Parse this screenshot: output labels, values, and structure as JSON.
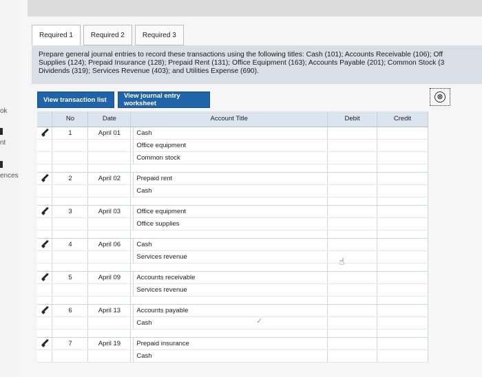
{
  "sidebar_fragments": [
    "ok",
    "nt",
    "ences"
  ],
  "tabs": [
    {
      "label": "Required 1"
    },
    {
      "label": "Required 2"
    },
    {
      "label": "Required 3"
    }
  ],
  "instruction": {
    "line1": "Prepare general journal entries to record these transactions using the following titles: Cash (101); Accounts Receivable (106); Off",
    "line2": "Supplies (124); Prepaid Insurance (128); Prepaid Rent (131); Office Equipment (163); Accounts Payable (201); Common Stock (3",
    "line3": "Dividends (319); Services Revenue (403); and Utilities Expense (690)."
  },
  "buttons": {
    "transaction_list": "View transaction list",
    "journal_worksheet": "View journal entry worksheet"
  },
  "close_icon": "⊗",
  "table": {
    "headers": {
      "no": "No",
      "date": "Date",
      "account": "Account Title",
      "debit": "Debit",
      "credit": "Credit"
    },
    "entries": [
      {
        "no": "1",
        "date": "April 01",
        "accounts": [
          "Cash",
          "Office equipment",
          "Common stock"
        ]
      },
      {
        "no": "2",
        "date": "April 02",
        "accounts": [
          "Prepaid rent",
          "Cash"
        ]
      },
      {
        "no": "3",
        "date": "April 03",
        "accounts": [
          "Office equipment",
          "Office supplies"
        ]
      },
      {
        "no": "4",
        "date": "April 06",
        "accounts": [
          "Cash",
          "Services revenue"
        ]
      },
      {
        "no": "5",
        "date": "April 09",
        "accounts": [
          "Accounts receivable",
          "Services revenue"
        ]
      },
      {
        "no": "6",
        "date": "April 13",
        "accounts": [
          "Accounts payable",
          "Cash"
        ]
      },
      {
        "no": "7",
        "date": "April 19",
        "accounts": [
          "Prepaid insurance",
          "Cash"
        ]
      }
    ]
  }
}
